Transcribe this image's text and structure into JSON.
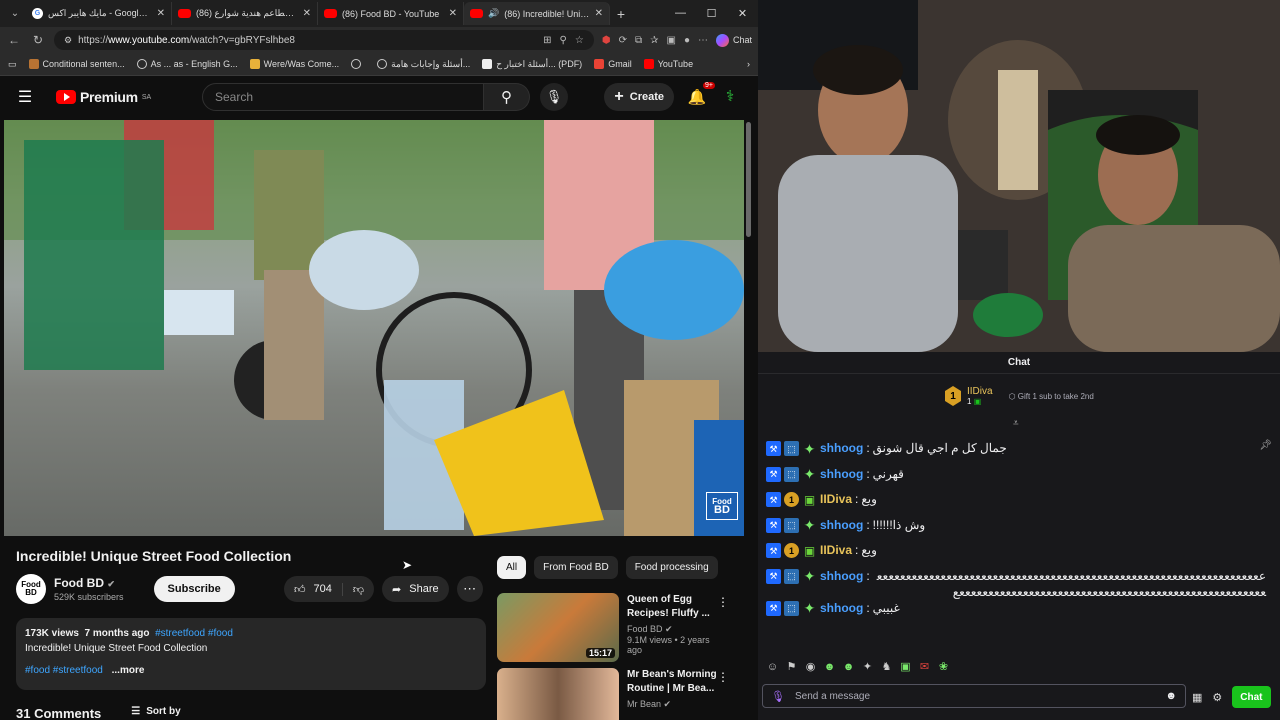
{
  "browser": {
    "tabs": [
      {
        "label": "مايك هايبر اكس - Google Search",
        "favicon": "google",
        "active": false
      },
      {
        "label": "(86) مطاعم هندية شوارع - YouTube",
        "favicon": "youtube",
        "active": false
      },
      {
        "label": "(86) Food BD - YouTube",
        "favicon": "youtube",
        "active": false
      },
      {
        "label": "(86) Incredible! Unique Str",
        "favicon": "youtube",
        "active": true
      }
    ],
    "url_prefix": "https://",
    "url_host": "www.youtube.com",
    "url_path": "/watch?v=gbRYFslhbe8",
    "chat_label": "Chat",
    "bookmarks": [
      "Conditional senten...",
      "As ... as - English G...",
      "Were/Was Come...",
      "",
      "أسئلة وإجابات هامة...",
      "أسئلة اختبار ح... (PDF)",
      "Gmail",
      "YouTube"
    ]
  },
  "youtube": {
    "brand": "Premium",
    "region": "SA",
    "search_placeholder": "Search",
    "create_label": "Create",
    "notif_count": "9+",
    "video": {
      "title": "Incredible! Unique Street Food Collection",
      "watermark_line1": "Food",
      "watermark_line2": "BD"
    },
    "channel": {
      "avatar_text": "Food BD",
      "name": "Food BD",
      "subscribers": "529K subscribers",
      "subscribe_label": "Subscribe"
    },
    "likes": "704",
    "share_label": "Share",
    "description": {
      "views": "173K views",
      "age": "7 months ago",
      "tags_top": "#streetfood #food",
      "line": "Incredible! Unique Street Food Collection",
      "tags_bottom": "#food #streetfood",
      "more": "...more"
    },
    "comments_label": "31 Comments",
    "sort_label": "Sort by",
    "chips": [
      "All",
      "From Food BD",
      "Food processing"
    ],
    "related": [
      {
        "title1": "Queen of Egg",
        "title2": "Recipes! Fluffy ...",
        "channel": "Food BD",
        "meta": "9.1M views • 2 years ago",
        "duration": "15:17"
      },
      {
        "title1": "Mr Bean's Morning",
        "title2": "Routine | Mr Bea...",
        "channel": "Mr Bean",
        "meta": "",
        "duration": ""
      }
    ]
  },
  "stream": {
    "chat_header": "Chat",
    "gifter_name": "IIDiva",
    "gifter_rank": "1",
    "gift_text": "Gift 1 sub to take 2nd",
    "messages": [
      {
        "user": "shhoog",
        "color": "#4a9fff",
        "badges": [
          "b1",
          "b2",
          "b3"
        ],
        "text": "جمال كل م اجي قال شونق"
      },
      {
        "user": "shhoog",
        "color": "#4a9fff",
        "badges": [
          "b1",
          "b2",
          "b3"
        ],
        "text": "قهرني"
      },
      {
        "user": "IIDiva",
        "color": "#e8c35a",
        "badges": [
          "b1",
          "b4",
          "b5"
        ],
        "text": "ويع"
      },
      {
        "user": "shhoog",
        "color": "#4a9fff",
        "badges": [
          "b1",
          "b2",
          "b3"
        ],
        "text": "وش ذا!!!!!!"
      },
      {
        "user": "IIDiva",
        "color": "#e8c35a",
        "badges": [
          "b1",
          "b4",
          "b5"
        ],
        "text": "ويع"
      },
      {
        "user": "shhoog",
        "color": "#4a9fff",
        "badges": [
          "b1",
          "b2",
          "b3"
        ],
        "text": "ععععععععععععععععععععععععععععععععععععععععععععععععععععععععععععععععععععععععععععععععععععععععععععععععععععععععععععععععععععععععع"
      },
      {
        "user": "shhoog",
        "color": "#4a9fff",
        "badges": [
          "b1",
          "b2",
          "b3"
        ],
        "text": "غبيبي"
      }
    ],
    "input_placeholder": "Send a message",
    "send_label": "Chat"
  }
}
